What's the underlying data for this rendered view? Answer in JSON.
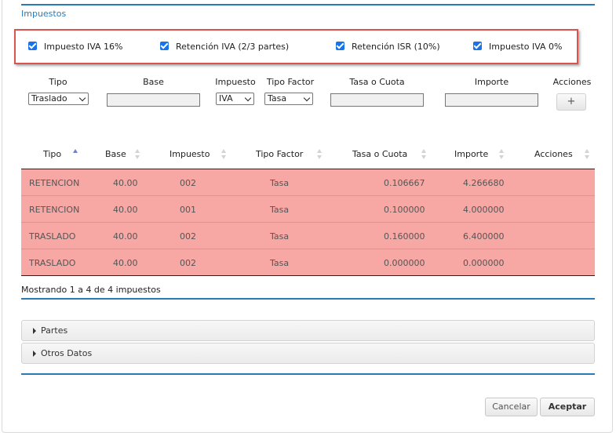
{
  "section": {
    "title": "Impuestos"
  },
  "checkboxes": [
    {
      "label": "Impuesto IVA 16%",
      "checked": true
    },
    {
      "label": "Retención IVA (2/3 partes)",
      "checked": true
    },
    {
      "label": "Retención ISR (10%)",
      "checked": true
    },
    {
      "label": "Impuesto IVA 0%",
      "checked": true
    }
  ],
  "form": {
    "labels": {
      "tipo": "Tipo",
      "base": "Base",
      "impuesto": "Impuesto",
      "tipo_factor": "Tipo Factor",
      "tasa": "Tasa o Cuota",
      "importe": "Importe",
      "acciones": "Acciones"
    },
    "tipo_value": "Traslado",
    "impuesto_value": "IVA",
    "tipo_factor_value": "Tasa",
    "base_value": "",
    "tasa_value": "",
    "importe_value": "",
    "add_label": "+"
  },
  "table": {
    "headers": [
      "Tipo",
      "Base",
      "Impuesto",
      "Tipo Factor",
      "Tasa o Cuota",
      "Importe",
      "Acciones"
    ],
    "sorted_column": "Tipo",
    "row_color": "#f8a8a4",
    "rows": [
      {
        "tipo": "RETENCION",
        "base": "40.00",
        "impuesto": "002",
        "tipo_factor": "Tasa",
        "tasa": "0.106667",
        "importe": "4.266680"
      },
      {
        "tipo": "RETENCION",
        "base": "40.00",
        "impuesto": "001",
        "tipo_factor": "Tasa",
        "tasa": "0.100000",
        "importe": "4.000000"
      },
      {
        "tipo": "TRASLADO",
        "base": "40.00",
        "impuesto": "002",
        "tipo_factor": "Tasa",
        "tasa": "0.160000",
        "importe": "6.400000"
      },
      {
        "tipo": "TRASLADO",
        "base": "40.00",
        "impuesto": "002",
        "tipo_factor": "Tasa",
        "tasa": "0.000000",
        "importe": "0.000000"
      }
    ],
    "info": "Mostrando 1 a 4 de 4 impuestos"
  },
  "accordions": [
    {
      "label": "Partes"
    },
    {
      "label": "Otros Datos"
    }
  ],
  "footer": {
    "cancel_label": "Cancelar",
    "accept_label": "Aceptar"
  },
  "colors": {
    "accent": "#2a7ab8",
    "highlight_border": "#d9534f",
    "checkbox": "#1a73e8"
  }
}
